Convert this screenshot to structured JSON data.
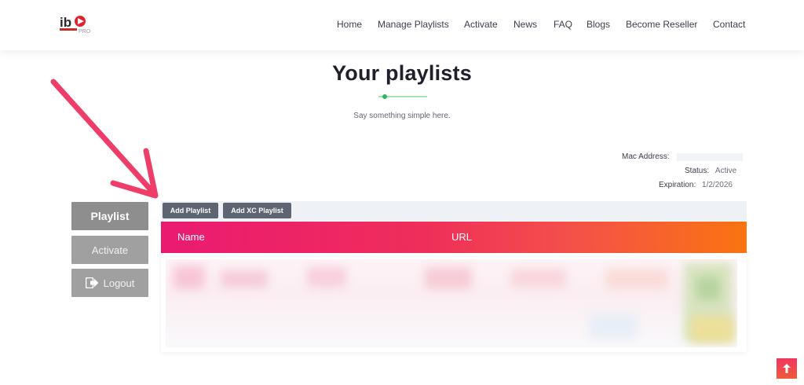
{
  "header": {
    "logo_icon": "ibo-player-pro-logo",
    "nav": [
      {
        "label": "Home"
      },
      {
        "label": "Manage Playlists"
      },
      {
        "label": "Activate"
      },
      {
        "label": "News"
      },
      {
        "label": "FAQ"
      },
      {
        "label": "Blogs"
      },
      {
        "label": "Become Reseller"
      },
      {
        "label": "Contact"
      }
    ]
  },
  "section": {
    "title": "Your playlists",
    "subtitle": "Say something simple here."
  },
  "device": {
    "mac_label": "Mac Address:",
    "mac_value": "",
    "status_label": "Status:",
    "status_value": "Active",
    "expiration_label": "Expiration:",
    "expiration_value": "1/2/2026"
  },
  "sidebar": {
    "items": [
      {
        "label": "Playlist",
        "active": true
      },
      {
        "label": "Activate",
        "active": false
      },
      {
        "label": "Logout",
        "icon": "logout-icon",
        "active": false
      }
    ]
  },
  "toolbar": {
    "add_playlist_label": "Add Playlist",
    "add_xc_playlist_label": "Add XC Playlist"
  },
  "table": {
    "columns": [
      "Name",
      "URL"
    ]
  },
  "colors": {
    "header_gradient_start": "#ea1a72",
    "header_gradient_end": "#fa7410",
    "arrow": "#ef3d6a",
    "button_gray": "#8e8e8e",
    "toolbar_button": "#5e6572",
    "accent_green": "#34b45e"
  },
  "scroll_top": {
    "icon": "arrow-up-icon"
  }
}
